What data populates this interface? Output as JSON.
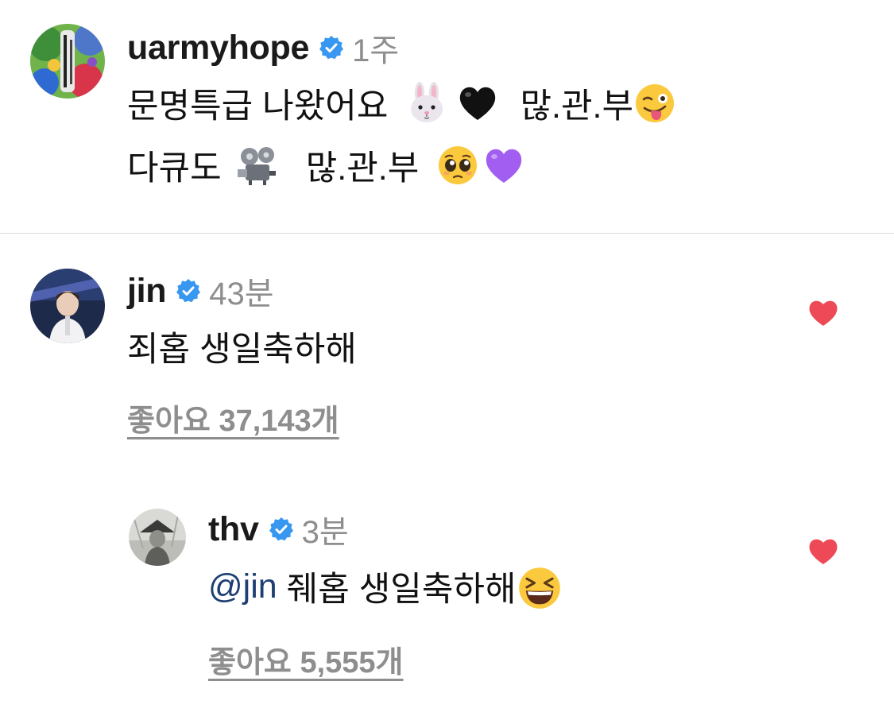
{
  "comments": [
    {
      "username": "uarmyhope",
      "time": "1주",
      "line1": {
        "text_a": "문명특급 나왔어요",
        "emoji_a": "rabbit-face-emoji",
        "emoji_b": "black-heart-emoji",
        "text_b": "많.관.부",
        "emoji_c": "winking-tongue-emoji"
      },
      "line2": {
        "text_a": "다큐도",
        "emoji_a": "film-projector-emoji",
        "text_b": "많.관.부",
        "emoji_b": "pleading-face-emoji",
        "emoji_c": "purple-heart-emoji"
      }
    },
    {
      "username": "jin",
      "time": "43분",
      "text": "죄홉 생일축하해",
      "likes": "좋아요 37,143개",
      "liked": true
    },
    {
      "username": "thv",
      "time": "3분",
      "mention": "@jin",
      "text": "줴홉 생일축하해",
      "emoji": "grinning-squinting-emoji",
      "likes": "좋아요 5,555개",
      "liked": true
    }
  ],
  "colors": {
    "heart_red": "#ed4956",
    "verified_blue": "#3897f0",
    "secondary_text": "#8e8e8e",
    "mention_blue": "#1e3f73"
  }
}
